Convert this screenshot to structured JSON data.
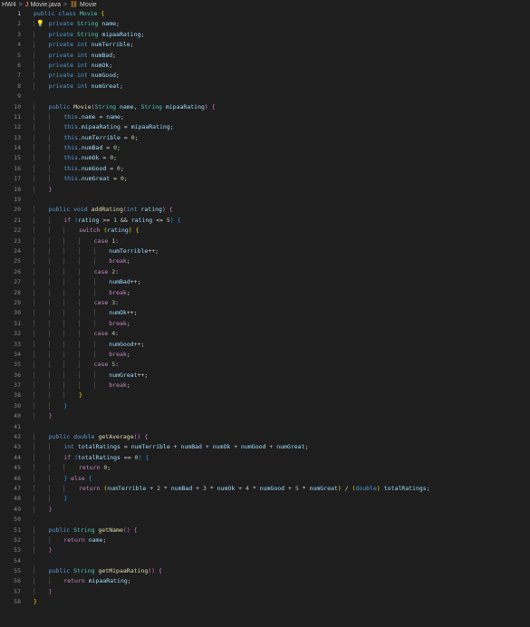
{
  "breadcrumb": {
    "folder": "HW4",
    "file": "Movie.java",
    "symbol": "Movie"
  },
  "icons": {
    "java_file": "java-file-icon",
    "class_symbol": "class-symbol-icon",
    "lightbulb": "lightbulb-icon"
  },
  "lines": [
    [
      [
        "kw",
        "public "
      ],
      [
        "kw",
        "class "
      ],
      [
        "ty",
        "Movie "
      ],
      [
        "p1",
        "{"
      ]
    ],
    [
      [
        "kw",
        "private "
      ],
      [
        "ty",
        "String "
      ],
      [
        "var",
        "name"
      ],
      [
        "",
        "; "
      ]
    ],
    [
      [
        "kw",
        "private "
      ],
      [
        "ty",
        "String "
      ],
      [
        "var",
        "mipaaRating"
      ],
      [
        "",
        ";"
      ]
    ],
    [
      [
        "kw",
        "private "
      ],
      [
        "kw",
        "int "
      ],
      [
        "var",
        "numTerrible"
      ],
      [
        "",
        ";"
      ]
    ],
    [
      [
        "kw",
        "private "
      ],
      [
        "kw",
        "int "
      ],
      [
        "var",
        "numBad"
      ],
      [
        "",
        ";"
      ]
    ],
    [
      [
        "kw",
        "private "
      ],
      [
        "kw",
        "int "
      ],
      [
        "var",
        "numOk"
      ],
      [
        "",
        ";"
      ]
    ],
    [
      [
        "kw",
        "private "
      ],
      [
        "kw",
        "int "
      ],
      [
        "var",
        "numGood"
      ],
      [
        "",
        ";"
      ]
    ],
    [
      [
        "kw",
        "private "
      ],
      [
        "kw",
        "int "
      ],
      [
        "var",
        "numGreat"
      ],
      [
        "",
        ";"
      ]
    ],
    [],
    [
      [
        "kw",
        "public "
      ],
      [
        "fn",
        "Movie"
      ],
      [
        "p2",
        "("
      ],
      [
        "ty",
        "String "
      ],
      [
        "var",
        "name"
      ],
      [
        "",
        ", "
      ],
      [
        "ty",
        "String "
      ],
      [
        "var",
        "mipaaRating"
      ],
      [
        "p2",
        ")"
      ],
      [
        "",
        " "
      ],
      [
        "p2",
        "{"
      ]
    ],
    [
      [
        "kw",
        "this"
      ],
      [
        "",
        "."
      ],
      [
        "var",
        "name"
      ],
      [
        "",
        " = "
      ],
      [
        "var",
        "name"
      ],
      [
        "",
        ";"
      ]
    ],
    [
      [
        "kw",
        "this"
      ],
      [
        "",
        "."
      ],
      [
        "var",
        "mipaaRating"
      ],
      [
        "",
        " = "
      ],
      [
        "var",
        "mipaaRating"
      ],
      [
        "",
        ";"
      ]
    ],
    [
      [
        "kw",
        "this"
      ],
      [
        "",
        "."
      ],
      [
        "var",
        "numTerrible"
      ],
      [
        "",
        " = "
      ],
      [
        "num",
        "0"
      ],
      [
        "",
        ";"
      ]
    ],
    [
      [
        "kw",
        "this"
      ],
      [
        "",
        "."
      ],
      [
        "var",
        "numBad"
      ],
      [
        "",
        " = "
      ],
      [
        "num",
        "0"
      ],
      [
        "",
        ";"
      ]
    ],
    [
      [
        "kw",
        "this"
      ],
      [
        "",
        "."
      ],
      [
        "var",
        "numOk"
      ],
      [
        "",
        " = "
      ],
      [
        "num",
        "0"
      ],
      [
        "",
        ";"
      ]
    ],
    [
      [
        "kw",
        "this"
      ],
      [
        "",
        "."
      ],
      [
        "var",
        "numGood"
      ],
      [
        "",
        " = "
      ],
      [
        "num",
        "0"
      ],
      [
        "",
        ";"
      ]
    ],
    [
      [
        "kw",
        "this"
      ],
      [
        "",
        "."
      ],
      [
        "var",
        "numGreat"
      ],
      [
        "",
        " = "
      ],
      [
        "num",
        "0"
      ],
      [
        "",
        ";"
      ]
    ],
    [
      [
        "p2",
        "}"
      ]
    ],
    [],
    [
      [
        "kw",
        "public "
      ],
      [
        "kw",
        "void "
      ],
      [
        "fn",
        "addRating"
      ],
      [
        "p2",
        "("
      ],
      [
        "kw",
        "int "
      ],
      [
        "var",
        "rating"
      ],
      [
        "p2",
        ")"
      ],
      [
        "",
        " "
      ],
      [
        "p2",
        "{"
      ]
    ],
    [
      [
        "ctl",
        "if "
      ],
      [
        "p3",
        "("
      ],
      [
        "var",
        "rating"
      ],
      [
        "",
        " >= "
      ],
      [
        "num",
        "1"
      ],
      [
        "",
        " && "
      ],
      [
        "var",
        "rating"
      ],
      [
        "",
        " <= "
      ],
      [
        "num",
        "5"
      ],
      [
        "p3",
        ")"
      ],
      [
        "",
        " "
      ],
      [
        "p3",
        "{"
      ]
    ],
    [
      [
        "ctl",
        "switch "
      ],
      [
        "p1",
        "("
      ],
      [
        "var",
        "rating"
      ],
      [
        "p1",
        ")"
      ],
      [
        "",
        " "
      ],
      [
        "p1",
        "{"
      ]
    ],
    [
      [
        "ctl",
        "case "
      ],
      [
        "num",
        "1"
      ],
      [
        "",
        ":"
      ]
    ],
    [
      [
        "var",
        "numTerrible"
      ],
      [
        "",
        "++;"
      ]
    ],
    [
      [
        "ctl",
        "break"
      ],
      [
        "",
        ";"
      ]
    ],
    [
      [
        "ctl",
        "case "
      ],
      [
        "num",
        "2"
      ],
      [
        "",
        ":"
      ]
    ],
    [
      [
        "var",
        "numBad"
      ],
      [
        "",
        "++;"
      ]
    ],
    [
      [
        "ctl",
        "break"
      ],
      [
        "",
        ";"
      ]
    ],
    [
      [
        "ctl",
        "case "
      ],
      [
        "num",
        "3"
      ],
      [
        "",
        ":"
      ]
    ],
    [
      [
        "var",
        "numOk"
      ],
      [
        "",
        "++;"
      ]
    ],
    [
      [
        "ctl",
        "break"
      ],
      [
        "",
        ";"
      ]
    ],
    [
      [
        "ctl",
        "case "
      ],
      [
        "num",
        "4"
      ],
      [
        "",
        ":"
      ]
    ],
    [
      [
        "var",
        "numGood"
      ],
      [
        "",
        "++;"
      ]
    ],
    [
      [
        "ctl",
        "break"
      ],
      [
        "",
        ";"
      ]
    ],
    [
      [
        "ctl",
        "case "
      ],
      [
        "num",
        "5"
      ],
      [
        "",
        ":"
      ]
    ],
    [
      [
        "var",
        "numGreat"
      ],
      [
        "",
        "++;"
      ]
    ],
    [
      [
        "ctl",
        "break"
      ],
      [
        "",
        ";"
      ]
    ],
    [
      [
        "p1",
        "}"
      ]
    ],
    [
      [
        "p3",
        "}"
      ]
    ],
    [
      [
        "p2",
        "}"
      ]
    ],
    [],
    [
      [
        "kw",
        "public "
      ],
      [
        "kw",
        "double "
      ],
      [
        "fn",
        "getAverage"
      ],
      [
        "p2",
        "()"
      ],
      [
        "",
        " "
      ],
      [
        "p2",
        "{"
      ]
    ],
    [
      [
        "kw",
        "int "
      ],
      [
        "var",
        "totalRatings"
      ],
      [
        "",
        " = "
      ],
      [
        "var",
        "numTerrible"
      ],
      [
        "",
        " + "
      ],
      [
        "var",
        "numBad"
      ],
      [
        "",
        " + "
      ],
      [
        "var",
        "numOk"
      ],
      [
        "",
        " + "
      ],
      [
        "var",
        "numGood"
      ],
      [
        "",
        " + "
      ],
      [
        "var",
        "numGreat"
      ],
      [
        "",
        ";"
      ]
    ],
    [
      [
        "ctl",
        "if "
      ],
      [
        "p3",
        "("
      ],
      [
        "var",
        "totalRatings"
      ],
      [
        "",
        " == "
      ],
      [
        "num",
        "0"
      ],
      [
        "p3",
        ")"
      ],
      [
        "",
        " "
      ],
      [
        "p3",
        "{"
      ]
    ],
    [
      [
        "ctl",
        "return "
      ],
      [
        "num",
        "0"
      ],
      [
        "",
        ";"
      ]
    ],
    [
      [
        "p3",
        "}"
      ],
      [
        "",
        " "
      ],
      [
        "ctl",
        "else "
      ],
      [
        "p3",
        "{"
      ]
    ],
    [
      [
        "ctl",
        "return "
      ],
      [
        "p1",
        "("
      ],
      [
        "var",
        "numTerrible"
      ],
      [
        "",
        " + "
      ],
      [
        "num",
        "2"
      ],
      [
        "",
        " * "
      ],
      [
        "var",
        "numBad"
      ],
      [
        "",
        " + "
      ],
      [
        "num",
        "3"
      ],
      [
        "",
        " * "
      ],
      [
        "var",
        "numOk"
      ],
      [
        "",
        " + "
      ],
      [
        "num",
        "4"
      ],
      [
        "",
        " * "
      ],
      [
        "var",
        "numGood"
      ],
      [
        "",
        " + "
      ],
      [
        "num",
        "5"
      ],
      [
        "",
        " * "
      ],
      [
        "var",
        "numGreat"
      ],
      [
        "p1",
        ")"
      ],
      [
        "",
        " / "
      ],
      [
        "p1",
        "("
      ],
      [
        "kw",
        "double"
      ],
      [
        "p1",
        ")"
      ],
      [
        "",
        " "
      ],
      [
        "var",
        "totalRatings"
      ],
      [
        "",
        ";"
      ]
    ],
    [
      [
        "p3",
        "}"
      ]
    ],
    [
      [
        "p2",
        "}"
      ]
    ],
    [],
    [
      [
        "kw",
        "public "
      ],
      [
        "ty",
        "String "
      ],
      [
        "fn",
        "getName"
      ],
      [
        "p2",
        "()"
      ],
      [
        "",
        " "
      ],
      [
        "p2",
        "{"
      ]
    ],
    [
      [
        "ctl",
        "return "
      ],
      [
        "var",
        "name"
      ],
      [
        "",
        ";"
      ]
    ],
    [
      [
        "p2",
        "}"
      ]
    ],
    [],
    [
      [
        "kw",
        "public "
      ],
      [
        "ty",
        "String "
      ],
      [
        "fn",
        "getMipaaRating"
      ],
      [
        "p2",
        "()"
      ],
      [
        "",
        " "
      ],
      [
        "p2",
        "{"
      ]
    ],
    [
      [
        "ctl",
        "return "
      ],
      [
        "var",
        "mipaaRating"
      ],
      [
        "",
        ";"
      ]
    ],
    [
      [
        "p2",
        "}"
      ]
    ],
    [
      [
        "p1",
        "}"
      ]
    ]
  ]
}
